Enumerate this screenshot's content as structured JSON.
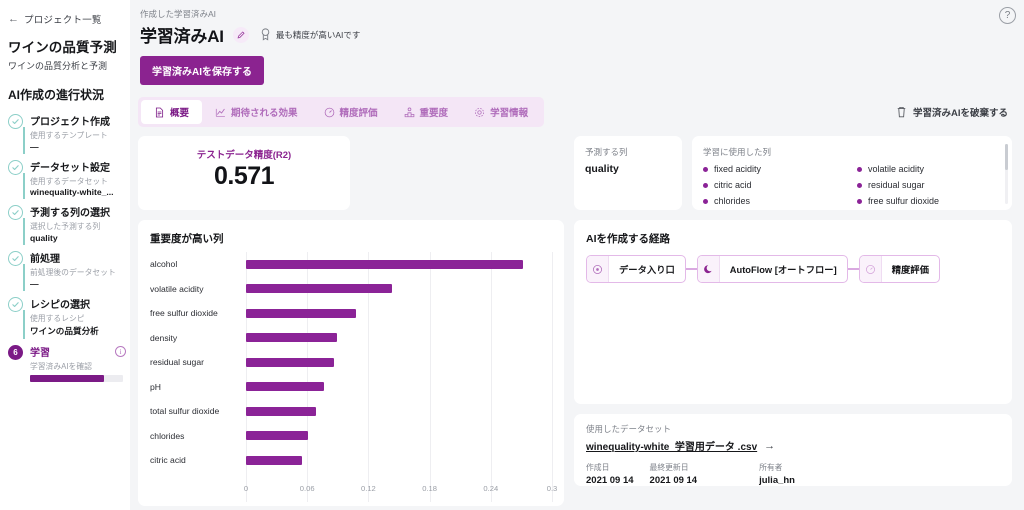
{
  "sidebar": {
    "back_label": "プロジェクト一覧",
    "back_icon": "arrow-left-icon",
    "project_title": "ワインの品質予測",
    "project_subtitle": "ワインの品質分析と予測",
    "section_title": "AI作成の進行状況",
    "steps": [
      {
        "status": "done",
        "marker": "check",
        "title": "プロジェクト作成",
        "sub": "使用するテンプレート",
        "value": "—"
      },
      {
        "status": "done",
        "marker": "check",
        "title": "データセット設定",
        "sub": "使用するデータセット",
        "value": "winequality-white_..."
      },
      {
        "status": "done",
        "marker": "check",
        "title": "予測する列の選択",
        "sub": "選択した予測する列",
        "value": "quality"
      },
      {
        "status": "done",
        "marker": "check",
        "title": "前処理",
        "sub": "前処理後のデータセット",
        "value": "—"
      },
      {
        "status": "done",
        "marker": "check",
        "title": "レシピの選択",
        "sub": "使用するレシピ",
        "value": "ワインの品質分析"
      },
      {
        "status": "current",
        "marker": "6",
        "title": "学習",
        "sub": "学習済みAIを確認",
        "value": "",
        "progress_percent": 80,
        "info_icon": "info-icon"
      }
    ]
  },
  "header": {
    "help_icon": "help-circle-icon",
    "eyebrow": "作成した学習済みAI",
    "title": "学習済みAI",
    "edit_icon": "pencil-icon",
    "badge_icon": "medal-icon",
    "badge_text": "最も精度が高いAIです",
    "save_label": "学習済みAIを保存する"
  },
  "tabs": [
    {
      "label": "概要",
      "icon": "document-icon",
      "active": true
    },
    {
      "label": "期待される効果",
      "icon": "line-chart-icon",
      "active": false
    },
    {
      "label": "精度評価",
      "icon": "gauge-icon",
      "active": false
    },
    {
      "label": "重要度",
      "icon": "podium-icon",
      "active": false
    },
    {
      "label": "学習情報",
      "icon": "gear-icon",
      "active": false
    }
  ],
  "discard": {
    "label": "学習済みAIを破棄する",
    "icon": "trash-icon"
  },
  "accuracy_card": {
    "label": "テストデータ精度(R2)",
    "value": "0.571"
  },
  "prediction_card": {
    "label": "予測する列",
    "value": "quality"
  },
  "training_columns_card": {
    "label": "学習に使用した列",
    "columns": [
      "fixed acidity",
      "volatile acidity",
      "citric acid",
      "residual sugar",
      "chlorides",
      "free sulfur dioxide"
    ]
  },
  "importance_card": {
    "title": "重要度が高い列"
  },
  "chart_data": {
    "type": "bar",
    "orientation": "horizontal",
    "title": "重要度が高い列",
    "xlabel": "",
    "ylabel": "",
    "categories": [
      "alcohol",
      "volatile acidity",
      "free sulfur dioxide",
      "density",
      "residual sugar",
      "pH",
      "total sulfur dioxide",
      "chlorides",
      "citric acid"
    ],
    "values": [
      0.272,
      0.143,
      0.108,
      0.089,
      0.086,
      0.076,
      0.069,
      0.061,
      0.055
    ],
    "xlim": [
      0,
      0.3
    ],
    "xticks": [
      "0",
      "0.06",
      "0.12",
      "0.18",
      "0.24",
      "0.3"
    ],
    "xtick_values": [
      0,
      0.06,
      0.12,
      0.18,
      0.24,
      0.3
    ],
    "grid": true,
    "legend": false,
    "bar_color": "#8b2397"
  },
  "path_card": {
    "title": "AIを作成する経路",
    "nodes": [
      {
        "label": "データ入り口",
        "icon": "data-entry-icon"
      },
      {
        "label": "AutoFlow [オートフロー]",
        "icon": "autoflow-icon"
      },
      {
        "label": "精度評価",
        "icon": "gauge-icon"
      }
    ]
  },
  "dataset_card": {
    "label": "使用したデータセット",
    "link": "winequality-white_学習用データ .csv",
    "arrow_icon": "arrow-right-icon",
    "created_label": "作成日",
    "created_value": "2021 09 14",
    "updated_label": "最終更新日",
    "updated_value": "2021 09 14",
    "owner_label": "所有者",
    "owner_value": "julia_hn"
  },
  "colors": {
    "accent_purple": "#8b2390",
    "bar_purple": "#8b2397",
    "tab_bg": "#f4e6f6",
    "step_done": "#8ccfc8",
    "page_bg": "#f4f5f7"
  }
}
